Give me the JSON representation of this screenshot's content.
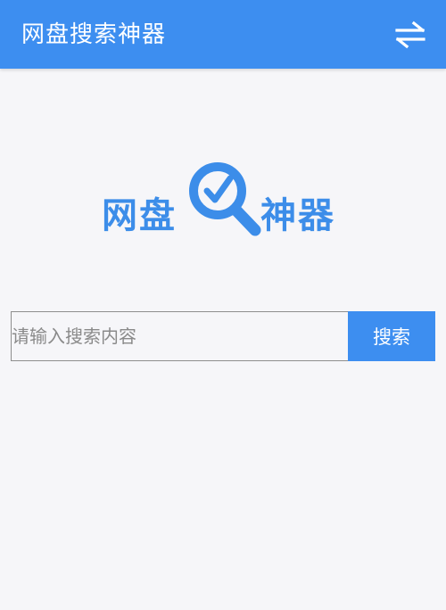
{
  "appbar": {
    "title": "网盘搜索神器",
    "swap_icon": "swap-arrows-icon"
  },
  "logo": {
    "left_text": "网盘",
    "right_text": "神器",
    "icon": "magnifier-check-icon"
  },
  "search": {
    "placeholder": "请输入搜索内容",
    "value": "",
    "button_label": "搜索"
  },
  "colors": {
    "primary": "#3d8ef0",
    "logo": "#3c8de9",
    "background": "#f6f6f9"
  }
}
